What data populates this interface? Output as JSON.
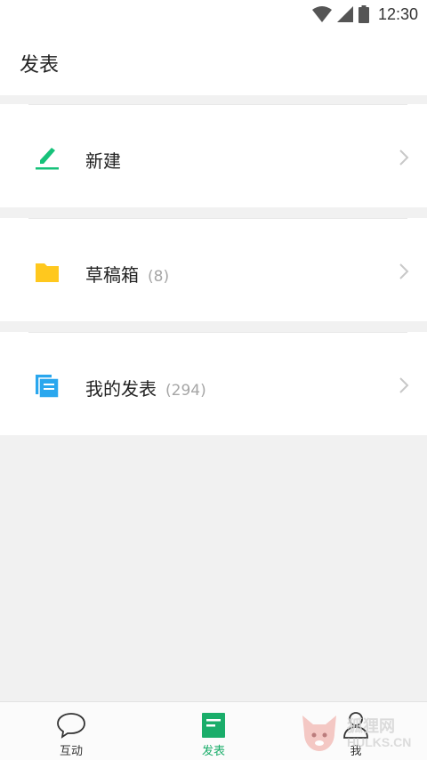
{
  "status_bar": {
    "time": "12:30"
  },
  "header": {
    "title": "发表"
  },
  "rows": [
    {
      "label": "新建",
      "count": "",
      "icon": "pen-icon"
    },
    {
      "label": "草稿箱",
      "count": "(8)",
      "icon": "folder-icon"
    },
    {
      "label": "我的发表",
      "count": "(294)",
      "icon": "documents-icon"
    }
  ],
  "tabs": [
    {
      "label": "互动",
      "icon": "chat-bubble-icon",
      "active": false
    },
    {
      "label": "发表",
      "icon": "document-icon",
      "active": true
    },
    {
      "label": "我",
      "icon": "person-icon",
      "active": false
    }
  ],
  "watermark": {
    "cn": "狐狸网",
    "en": "HULKS.CN"
  },
  "colors": {
    "accent_green": "#1aad6a",
    "pen_green": "#16c27a",
    "folder_yellow": "#ffc81e",
    "doc_blue": "#2aa7ee",
    "background": "#f1f1f1"
  }
}
